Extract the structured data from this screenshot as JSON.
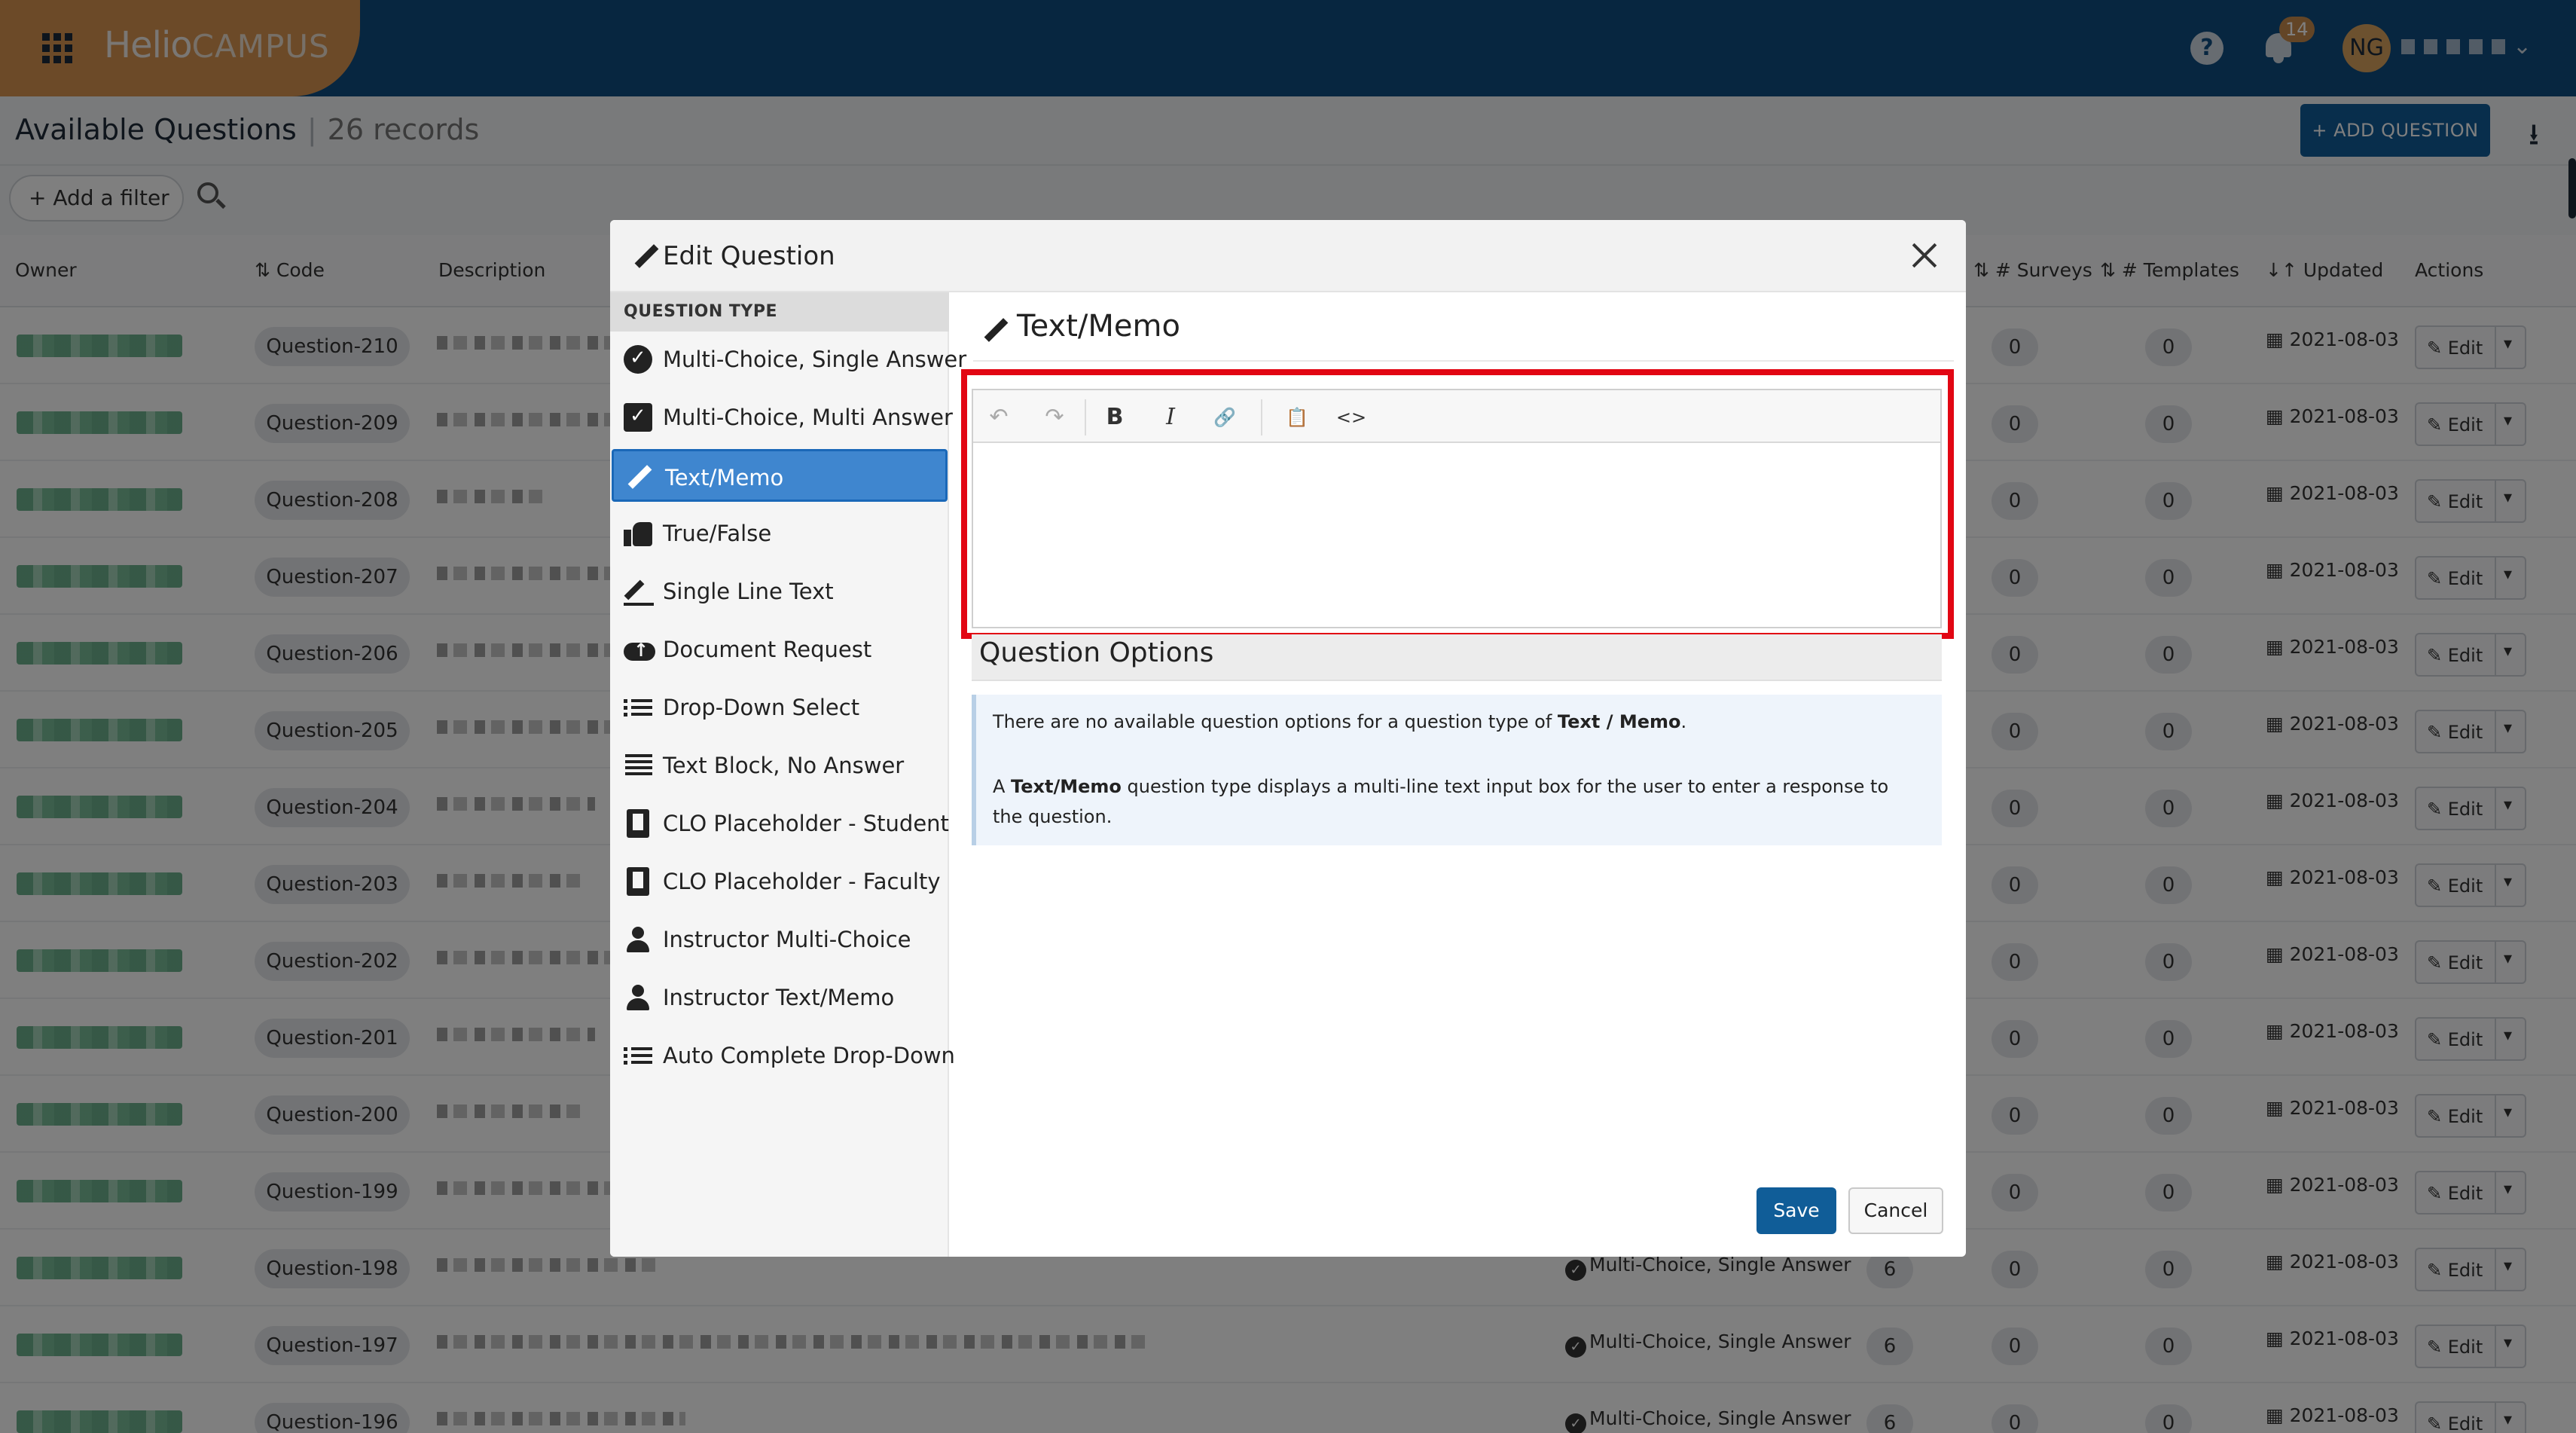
{
  "app": {
    "logo_main": "Helio",
    "logo_sub": "CAMPUS",
    "notifications": "14",
    "user_initials": "NG"
  },
  "header": {
    "title": "Available Questions",
    "separator": "|",
    "count": "26 records",
    "add_question": "+ ADD QUESTION"
  },
  "filter": {
    "add_filter": "Add a filter"
  },
  "table": {
    "columns": {
      "owner": "Owner",
      "code": "Code",
      "description": "Description",
      "surveys": "# Surveys",
      "templates": "# Templates",
      "updated": "Updated",
      "actions": "Actions"
    },
    "rows": [
      {
        "code": "Question-210",
        "surveys": "0",
        "templates": "0",
        "updated": "2021-08-03",
        "edit": "Edit"
      },
      {
        "code": "Question-209",
        "surveys": "0",
        "templates": "0",
        "updated": "2021-08-03",
        "edit": "Edit"
      },
      {
        "code": "Question-208",
        "surveys": "0",
        "templates": "0",
        "updated": "2021-08-03",
        "edit": "Edit"
      },
      {
        "code": "Question-207",
        "surveys": "0",
        "templates": "0",
        "updated": "2021-08-03",
        "edit": "Edit"
      },
      {
        "code": "Question-206",
        "surveys": "0",
        "templates": "0",
        "updated": "2021-08-03",
        "edit": "Edit"
      },
      {
        "code": "Question-205",
        "surveys": "0",
        "templates": "0",
        "updated": "2021-08-03",
        "edit": "Edit"
      },
      {
        "code": "Question-204",
        "surveys": "0",
        "templates": "0",
        "updated": "2021-08-03",
        "edit": "Edit"
      },
      {
        "code": "Question-203",
        "surveys": "0",
        "templates": "0",
        "updated": "2021-08-03",
        "edit": "Edit"
      },
      {
        "code": "Question-202",
        "surveys": "0",
        "templates": "0",
        "updated": "2021-08-03",
        "edit": "Edit"
      },
      {
        "code": "Question-201",
        "surveys": "0",
        "templates": "0",
        "updated": "2021-08-03",
        "edit": "Edit"
      },
      {
        "code": "Question-200",
        "surveys": "0",
        "templates": "0",
        "updated": "2021-08-03",
        "edit": "Edit"
      },
      {
        "code": "Question-199",
        "surveys": "0",
        "templates": "0",
        "updated": "2021-08-03",
        "edit": "Edit"
      },
      {
        "code": "Question-198",
        "type": "Multi-Choice, Single Answer",
        "qcount": "6",
        "surveys": "0",
        "templates": "0",
        "updated": "2021-08-03",
        "edit": "Edit"
      },
      {
        "code": "Question-197",
        "type": "Multi-Choice, Single Answer",
        "qcount": "6",
        "surveys": "0",
        "templates": "0",
        "updated": "2021-08-03",
        "edit": "Edit"
      },
      {
        "code": "Question-196",
        "type": "Multi-Choice, Single Answer",
        "qcount": "6",
        "surveys": "0",
        "templates": "0",
        "updated": "2021-08-03",
        "edit": "Edit"
      }
    ]
  },
  "modal": {
    "title": "Edit Question",
    "question_type_header": "QUESTION TYPE",
    "types": [
      {
        "label": "Multi-Choice, Single Answer",
        "icon": "circle-check-icon"
      },
      {
        "label": "Multi-Choice, Multi Answer",
        "icon": "square-check-icon"
      },
      {
        "label": "Text/Memo",
        "icon": "pencil-icon",
        "active": true
      },
      {
        "label": "True/False",
        "icon": "thumbs-up-icon"
      },
      {
        "label": "Single Line Text",
        "icon": "pen-line-icon"
      },
      {
        "label": "Document Request",
        "icon": "cloud-upload-icon"
      },
      {
        "label": "Drop-Down Select",
        "icon": "list-icon"
      },
      {
        "label": "Text Block, No Answer",
        "icon": "align-justify-icon"
      },
      {
        "label": "CLO Placeholder - Student",
        "icon": "book-icon"
      },
      {
        "label": "CLO Placeholder - Faculty",
        "icon": "book-icon"
      },
      {
        "label": "Instructor Multi-Choice",
        "icon": "user-icon"
      },
      {
        "label": "Instructor Text/Memo",
        "icon": "user-icon"
      },
      {
        "label": "Auto Complete Drop-Down",
        "icon": "list-icon"
      }
    ],
    "main_title": "Text/Memo",
    "toolbar": {
      "undo": "↶",
      "redo": "↷",
      "bold": "B",
      "italic": "I",
      "link": "🔗",
      "paste": "📋",
      "code": "<>"
    },
    "options_title": "Question Options",
    "info_line1_pre": "There are no available question options for a question type of ",
    "info_line1_bold": "Text / Memo",
    "info_line1_post": ".",
    "info_line2_pre": "A ",
    "info_line2_bold": "Text/Memo",
    "info_line2_post": " question type displays a multi-line text input box for the user to enter a response to the question.",
    "save": "Save",
    "cancel": "Cancel"
  }
}
